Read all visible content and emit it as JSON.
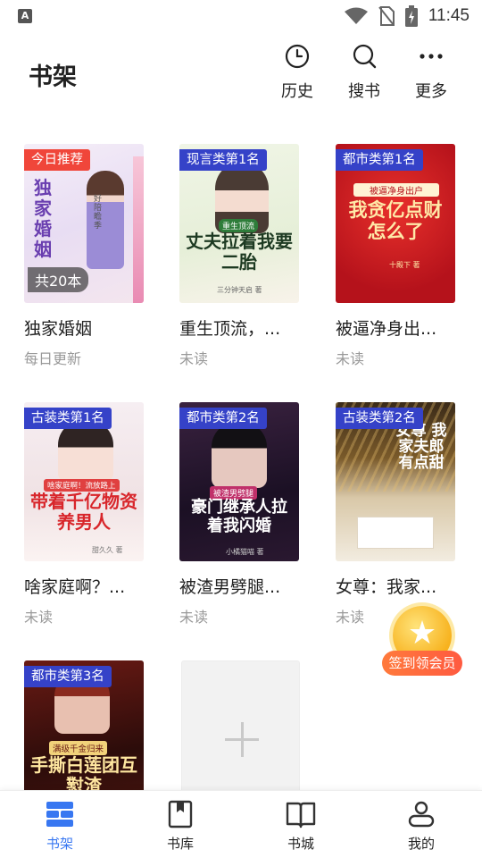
{
  "status_bar": {
    "time": "11:45",
    "notif_glyph": "A"
  },
  "header": {
    "title": "书架",
    "actions": [
      {
        "label": "历史",
        "icon": "clock-icon"
      },
      {
        "label": "搜书",
        "icon": "search-icon"
      },
      {
        "label": "更多",
        "icon": "more-icon"
      }
    ]
  },
  "books": [
    {
      "title": "独家婚姻",
      "status": "每日更新",
      "badge": "今日推荐",
      "badge_color": "#f0463a",
      "cover_text": "独家婚姻",
      "cover_author": "好陪瞻季",
      "count_label": "共20本"
    },
    {
      "title": "重生顶流，...",
      "status": "未读",
      "badge": "现言类第1名",
      "badge_color": "#3542c8",
      "cover_text": "丈夫拉着我要二胎",
      "cover_tag": "重生顶流",
      "cover_author": "三分钟天启 著"
    },
    {
      "title": "被逼净身出...",
      "status": "未读",
      "badge": "都市类第1名",
      "badge_color": "#3542c8",
      "cover_text": "我贪亿点财怎么了",
      "cover_tag": "被逼净身出户",
      "cover_author": "十殿下 著"
    },
    {
      "title": "啥家庭啊？...",
      "status": "未读",
      "badge": "古装类第1名",
      "badge_color": "#3542c8",
      "cover_text": "带着千亿物资养男人",
      "cover_tag": "啥家庭啊！流放路上",
      "cover_author": "甜久久 著"
    },
    {
      "title": "被渣男劈腿...",
      "status": "未读",
      "badge": "都市类第2名",
      "badge_color": "#3542c8",
      "cover_text": "豪门继承人拉着我闪婚",
      "cover_tag": "被渣男劈腿",
      "cover_author": "小橘猫喵 著"
    },
    {
      "title": "女尊：我家...",
      "status": "未读",
      "badge": "古装类第2名",
      "badge_color": "#3542c8",
      "cover_text": "女尊 我家夫郎有点甜",
      "cover_author": ""
    },
    {
      "title": "",
      "status": "",
      "badge": "都市类第3名",
      "badge_color": "#3542c8",
      "cover_text": "手撕白莲团互懟渣",
      "cover_tag": "满级千金归来",
      "cover_author": ""
    }
  ],
  "sign_in": {
    "label": "签到领会员"
  },
  "nav": [
    {
      "label": "书架",
      "icon": "bookshelf-icon",
      "active": true
    },
    {
      "label": "书库",
      "icon": "library-icon",
      "active": false
    },
    {
      "label": "书城",
      "icon": "bookstore-icon",
      "active": false
    },
    {
      "label": "我的",
      "icon": "profile-icon",
      "active": false
    }
  ],
  "colors": {
    "accent": "#3877f1",
    "badge_blue": "#3542c8",
    "badge_red": "#f0463a",
    "muted": "#999999"
  }
}
